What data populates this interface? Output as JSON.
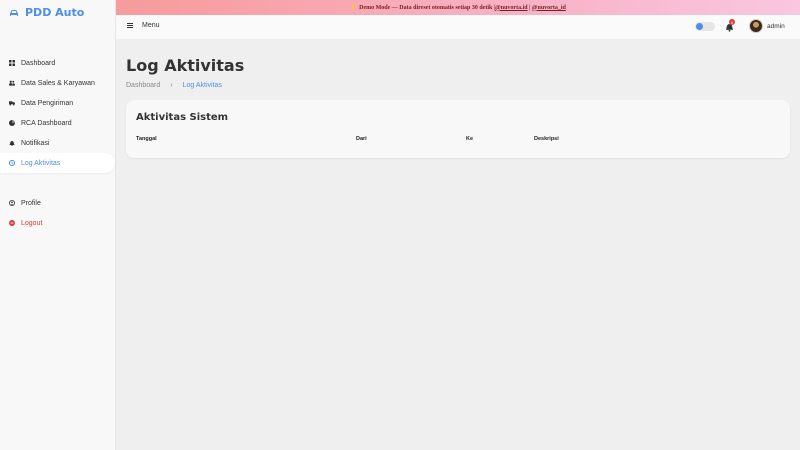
{
  "brand": {
    "name": "PDD Auto",
    "color": "#4b8fe8"
  },
  "sidebar": {
    "items": [
      {
        "label": "Dashboard",
        "icon": "grid-icon",
        "active": false
      },
      {
        "label": "Data Sales & Karyawan",
        "icon": "users-icon",
        "active": false
      },
      {
        "label": "Data Pengiriman",
        "icon": "truck-icon",
        "active": false
      },
      {
        "label": "RCA Dashboard",
        "icon": "chart-icon",
        "active": false
      },
      {
        "label": "Notifikasi",
        "icon": "bell-icon",
        "active": false
      },
      {
        "label": "Log Aktivitas",
        "icon": "history-icon",
        "active": true
      }
    ],
    "bottom": [
      {
        "label": "Profile",
        "icon": "user-circle-icon"
      },
      {
        "label": "Logout",
        "icon": "logout-icon"
      }
    ]
  },
  "banner": {
    "text": "⚡ Demo Mode — Data direset otomatis setiap 30 detik | ",
    "link1": "@nuvorta.id",
    "sep": " | ",
    "link2": "@nuvorta_id"
  },
  "topbar": {
    "menu_label": "Menu",
    "notification_count": "0",
    "username": "admin"
  },
  "main": {
    "title": "Log Aktivitas",
    "breadcrumb": {
      "home": "Dashboard",
      "separator": "›",
      "current": "Log Aktivitas"
    },
    "card": {
      "title": "Aktivitas Sistem",
      "columns": [
        "Tanggal",
        "Dari",
        "Ke",
        "Deskripsi"
      ]
    }
  }
}
